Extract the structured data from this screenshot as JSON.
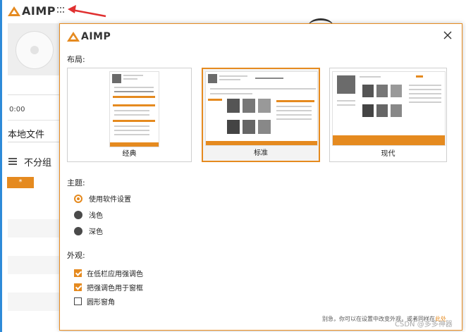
{
  "background_app": {
    "logo_text": "AIMP",
    "time": "0:00",
    "tab_label": "本地文件",
    "group_label": "不分组",
    "star_tab": "*"
  },
  "dialog": {
    "logo_text": "AIMP",
    "layout_section": "布局:",
    "layouts": [
      {
        "label": "经典",
        "selected": false
      },
      {
        "label": "标准",
        "selected": true
      },
      {
        "label": "现代",
        "selected": false
      }
    ],
    "theme_section": "主题:",
    "themes": [
      {
        "label": "使用软件设置",
        "selected": true
      },
      {
        "label": "浅色",
        "selected": false
      },
      {
        "label": "深色",
        "selected": false
      }
    ],
    "appearance_section": "外观:",
    "appearance_options": [
      {
        "label": "在低栏应用强调色",
        "checked": true
      },
      {
        "label": "把强调色用于窗框",
        "checked": true
      },
      {
        "label": "圆形窗角",
        "checked": false
      }
    ],
    "footer_note": "别急，你可以在设置中改变外观，或者同样在",
    "footer_link": "此处",
    "watermark": "CSDN @多多神器"
  },
  "colors": {
    "accent": "#e58a1f",
    "annotation_arrow": "#e03030",
    "left_bar": "#2e8ad8"
  }
}
